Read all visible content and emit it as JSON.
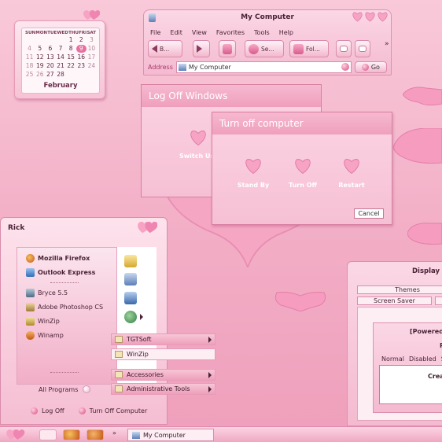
{
  "colors": {
    "accent": "#e86fa0",
    "heart_light": "#f9a8c8",
    "heart_dark": "#e05a92",
    "desktop": "#f2adc5"
  },
  "calendar": {
    "day_headers": [
      "SUN",
      "MON",
      "TUE",
      "WED",
      "THU",
      "FRI",
      "SAT"
    ],
    "days": [
      {
        "d": "",
        "dim": false
      },
      {
        "d": "",
        "dim": false
      },
      {
        "d": "",
        "dim": false
      },
      {
        "d": "",
        "dim": false
      },
      {
        "d": "1",
        "dim": false
      },
      {
        "d": "2",
        "dim": false
      },
      {
        "d": "3",
        "dim": true
      },
      {
        "d": "4",
        "dim": true
      },
      {
        "d": "5",
        "dim": false
      },
      {
        "d": "6",
        "dim": false
      },
      {
        "d": "7",
        "dim": false
      },
      {
        "d": "8",
        "dim": false
      },
      {
        "d": "9",
        "dim": false,
        "today": true
      },
      {
        "d": "10",
        "dim": true
      },
      {
        "d": "11",
        "dim": true
      },
      {
        "d": "12",
        "dim": false
      },
      {
        "d": "13",
        "dim": false
      },
      {
        "d": "14",
        "dim": false
      },
      {
        "d": "15",
        "dim": false
      },
      {
        "d": "16",
        "dim": false
      },
      {
        "d": "17",
        "dim": true
      },
      {
        "d": "18",
        "dim": true
      },
      {
        "d": "19",
        "dim": false
      },
      {
        "d": "20",
        "dim": false
      },
      {
        "d": "21",
        "dim": false
      },
      {
        "d": "22",
        "dim": false
      },
      {
        "d": "23",
        "dim": false
      },
      {
        "d": "24",
        "dim": true
      },
      {
        "d": "25",
        "dim": true
      },
      {
        "d": "26",
        "dim": true
      },
      {
        "d": "27",
        "dim": false
      },
      {
        "d": "28",
        "dim": false
      }
    ],
    "month": "February"
  },
  "my_computer": {
    "title": "My Computer",
    "menu": [
      "File",
      "Edit",
      "View",
      "Favorites",
      "Tools",
      "Help"
    ],
    "back_label": "B...",
    "search_label": "Se...",
    "folders_label": "Fol...",
    "address_label": "Address",
    "address_value": "My Computer",
    "go_label": "Go",
    "overflow": "»"
  },
  "logoff_dialog": {
    "title": "Log Off Windows",
    "switch_user": "Switch Use"
  },
  "turnoff_dialog": {
    "title": "Turn off computer",
    "options": [
      "Stand By",
      "Turn Off",
      "Restart"
    ],
    "cancel": "Cancel"
  },
  "start_menu": {
    "user": "Rick",
    "pinned": [
      "Mozilla Firefox",
      "Outlook Express"
    ],
    "recent": [
      "Bryce 5.5",
      "Adobe Photoshop CS",
      "WinZip",
      "Winamp"
    ],
    "all_programs": "All Programs",
    "log_off": "Log Off",
    "turn_off": "Turn Off Computer"
  },
  "submenu": {
    "items": [
      "TGTSoft",
      "WinZip",
      "Accessories",
      "Administrative Tools"
    ]
  },
  "display_properties": {
    "title": "Display P",
    "tab_themes": "Themes",
    "tab_screen_saver": "Screen Saver"
  },
  "powered_window": {
    "title": "[Powered",
    "p_char": "P",
    "tabs": [
      "Normal",
      "Disabled",
      "S"
    ],
    "crea": "Crea"
  },
  "taskbar": {
    "task": "My Computer",
    "chevron": "»"
  }
}
